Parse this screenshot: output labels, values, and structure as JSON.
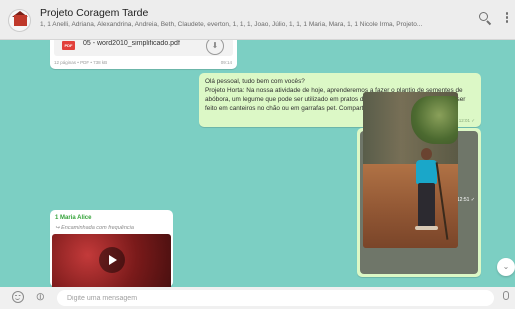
{
  "header": {
    "group_name": "Projeto Coragem Tarde",
    "participants": "1, 1 Anelli, Adriana, Alexandrina, Andreia, Beth, Claudete, everton, 1, 1, 1, Joao, Júlio, 1, 1, 1 Maria, Mara, 1, 1 Nicole Irma, Projeto...",
    "search_icon": "search-icon",
    "menu_icon": "kebab-menu-icon"
  },
  "messages": {
    "document": {
      "file_name": "05 - word2010_simplificado.pdf",
      "file_type_badge": "PDF",
      "meta": "12 páginas • PDF • 738 kB",
      "time": "09:14"
    },
    "outgoing_text": {
      "text": "Olá pessoal, tudo bem com vocês?\nProjeto Horta: Na nossa atividade de hoje, aprenderemos a fazer o plantio de sementes de abóbora, um legume que pode ser utilizado em pratos doces e salgados. O plantio pode ser feito em canteiros no chão ou em garrafas pet. Compartilhe conosco fotos do seu plantio.",
      "time": "12:01 ✓"
    },
    "outgoing_photo": {
      "time": "12:51 ✓"
    },
    "incoming_video": {
      "sender": "1 Maria Alice",
      "forwarded_label": "Encaminhada com frequência"
    }
  },
  "composer": {
    "placeholder": "Digite uma mensagem"
  },
  "colors": {
    "chat_background": "#7ccfc3",
    "outgoing_bubble": "#dcf8c6",
    "incoming_bubble": "#ffffff",
    "sender_name": "#35a33a"
  }
}
